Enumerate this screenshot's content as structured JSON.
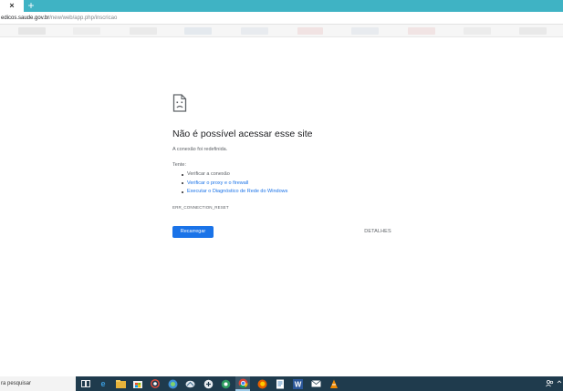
{
  "browser": {
    "tab_close_glyph": "×",
    "new_tab_glyph": "+",
    "url_domain": "edicos.saude.gov.br",
    "url_path": "/new/web/app.php/inscricao"
  },
  "error_page": {
    "title": "Não é possível acessar esse site",
    "description": "A conexão foi redefinida.",
    "try_label": "Tente:",
    "suggestions": [
      "Verificar a conexão",
      "Verificar o proxy e o firewall",
      "Executar o Diagnóstico de Rede do Windows"
    ],
    "error_code": "ERR_CONNECTION_RESET",
    "reload_label": "Recarregar",
    "details_label": "DETALHES"
  },
  "taskbar": {
    "search_text": "ra pesquisar",
    "icons": [
      "task-view-icon",
      "edge-icon",
      "file-explorer-icon",
      "store-icon",
      "app-icon",
      "photos-icon",
      "app-icon",
      "app-icon",
      "app-icon",
      "chrome-icon",
      "firefox-icon",
      "app-icon",
      "word-icon",
      "mail-icon",
      "vlc-icon"
    ]
  },
  "colors": {
    "tab_strip": "#3fb3c4",
    "primary_button": "#1a73e8",
    "link": "#1a73e8",
    "taskbar": "#1f3b4d"
  }
}
